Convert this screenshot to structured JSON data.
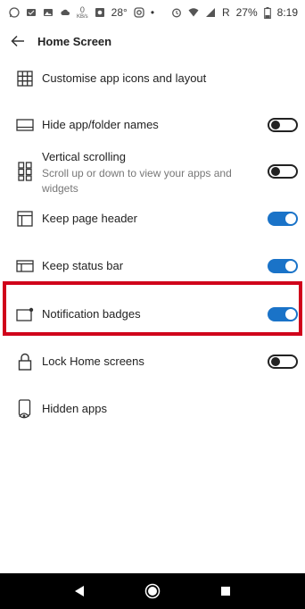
{
  "status_bar": {
    "net_speed_value": "0",
    "net_speed_unit": "KB/s",
    "temperature": "28°",
    "carrier_letter": "R",
    "battery": "27%",
    "time": "8:19"
  },
  "header": {
    "title": "Home Screen",
    "back_icon": "arrow-left-icon"
  },
  "settings": [
    {
      "label": "Customise app icons and layout",
      "icon": "grid-icon"
    },
    {
      "label": "Hide app/folder names",
      "icon": "rectangle-icon",
      "toggle": false
    },
    {
      "label": "Vertical scrolling",
      "sublabel": "Scroll up or down to view your apps and widgets",
      "icon": "vertical-scroll-icon",
      "toggle": false
    },
    {
      "label": "Keep page header",
      "icon": "page-header-icon",
      "toggle": true
    },
    {
      "label": "Keep status bar",
      "icon": "status-bar-icon",
      "toggle": true
    },
    {
      "label": "Notification badges",
      "icon": "badge-icon",
      "toggle": true
    },
    {
      "label": "Lock Home screens",
      "icon": "lock-icon",
      "toggle": false
    },
    {
      "label": "Hidden apps",
      "icon": "hidden-apps-icon"
    }
  ],
  "colors": {
    "accent": "#1a73c8",
    "highlight": "#d0021b"
  },
  "nav": [
    "back-icon",
    "home-icon",
    "recents-icon"
  ]
}
